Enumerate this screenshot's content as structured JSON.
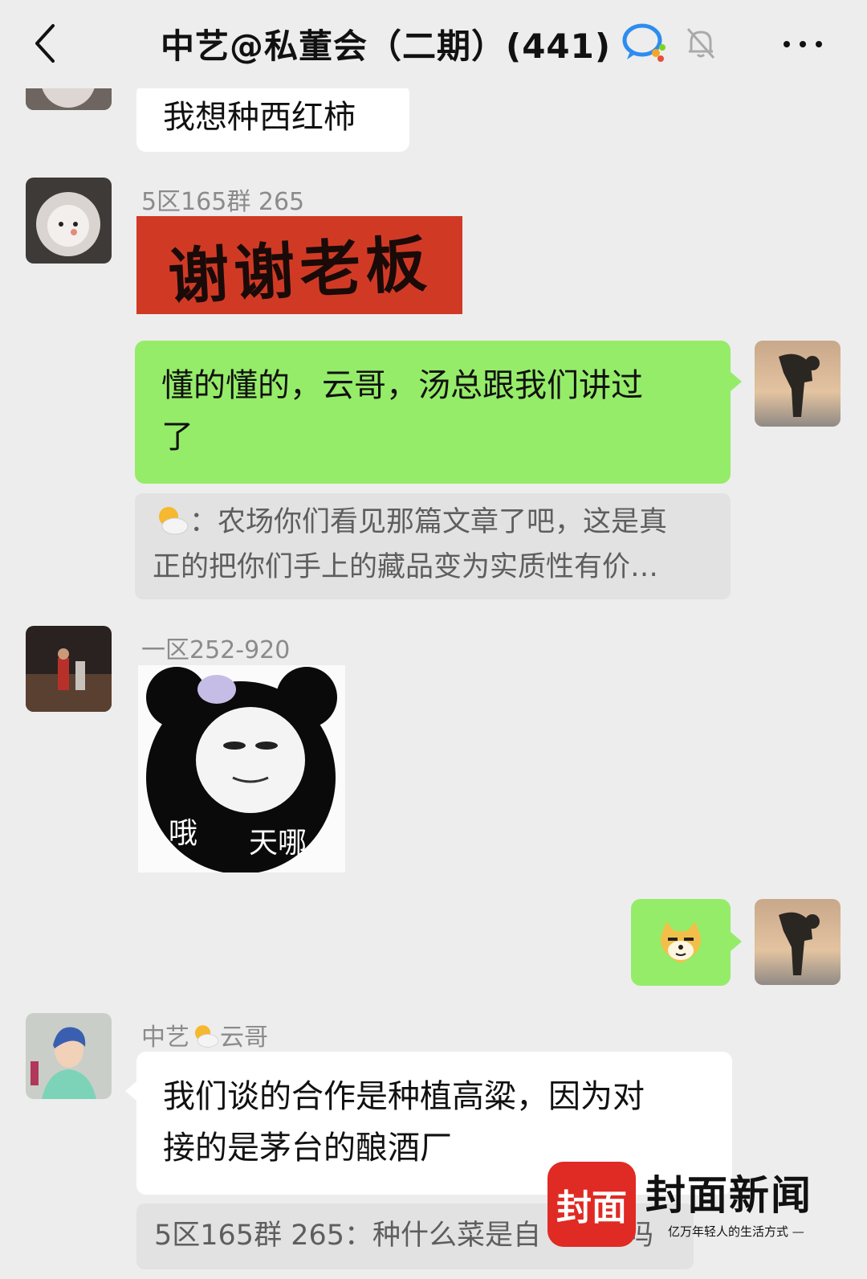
{
  "header": {
    "title": "中艺@私董会（二期）(441)"
  },
  "messages": [
    {
      "side": "left",
      "text": "我想种西红柿"
    },
    {
      "side": "left",
      "sender": "5区165群 265",
      "sticker_text": "谢谢老板"
    },
    {
      "side": "right",
      "text_line1": "懂的懂的，云哥，汤总跟我们讲过",
      "text_line2": "了",
      "quote_line1": "：农场你们看见那篇文章了吧，这是真",
      "quote_line2": "正的把你们手上的藏品变为实质性有价…"
    },
    {
      "side": "left",
      "sender": "一区252-920",
      "sticker_caption_left": "哦",
      "sticker_caption_right": "天哪"
    },
    {
      "side": "right",
      "emoji": "doge-emoji"
    },
    {
      "side": "left",
      "sender_prefix": "中艺",
      "sender_suffix": "云哥",
      "text_line1": "我们谈的合作是种植高粱，因为对",
      "text_line2": "接的是茅台的酿酒厂",
      "quote": "5区165群 265：种什么菜是自　　定吗"
    }
  ],
  "watermark": {
    "logo": "封面",
    "name": "封面新闻",
    "slogan": "亿万年轻人的生活方式 —"
  },
  "colors": {
    "background": "#ededed",
    "bubble_green": "#95ec69",
    "bubble_white": "#ffffff",
    "sender_gray": "#8b8b8b",
    "brand_red": "#e02a24"
  }
}
